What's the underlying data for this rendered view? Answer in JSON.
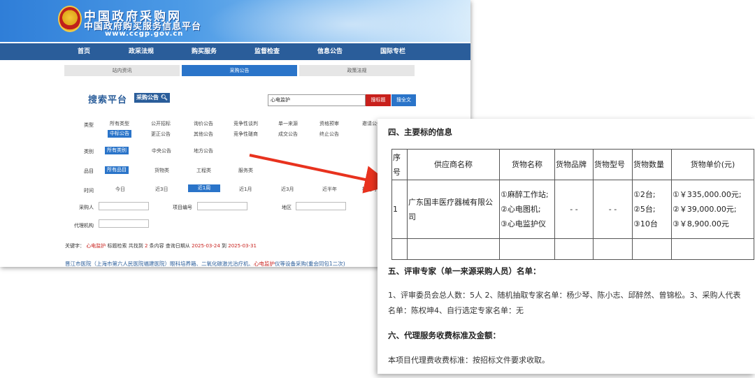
{
  "site": {
    "title": "中国政府采购网",
    "subtitle": "中国政府购买服务信息平台",
    "domain": "www.ccgp.gov.cn"
  },
  "nav": {
    "items": [
      "首页",
      "政采法规",
      "购买服务",
      "监督检查",
      "信息公告",
      "国际专栏"
    ]
  },
  "subtabs": {
    "items": [
      "站内资讯",
      "采购公告",
      "政策法规"
    ],
    "active_index": 1
  },
  "search": {
    "logo_text": "搜索平台",
    "logo_badge": "采购公告",
    "query": "心电监护",
    "btn_title": "搜标题",
    "btn_full": "搜全文"
  },
  "filters": {
    "type_label": "类型",
    "type_row1": [
      "所有类型",
      "公开招标",
      "询价公告",
      "竞争性谈判",
      "单一来源",
      "资格预审",
      "邀请公告"
    ],
    "type_row2": [
      "中标公告",
      "更正公告",
      "其他公告",
      "竞争性磋商",
      "成交公告",
      "终止公告"
    ],
    "category_label": "类别",
    "category_options": [
      "所有类别",
      "中央公告",
      "地方公告"
    ],
    "item_label": "品目",
    "item_options": [
      "所有品目",
      "货物类",
      "工程类",
      "服务类"
    ],
    "time_label": "时间",
    "time_options": [
      "今日",
      "近3日",
      "近1周",
      "近1月",
      "近3月",
      "近半年",
      "指定时"
    ],
    "purchaser_label": "采购人",
    "project_no_label": "项目编号",
    "region_label": "地区",
    "agency_label": "代理机构"
  },
  "results": {
    "keyword_label": "关键字：",
    "keyword": "心电监护",
    "summary_a": "标题检索 共找到",
    "count": "2",
    "summary_b": "条内容 查询日期从",
    "date_from": "2025-03-24",
    "summary_c": "到",
    "date_to": "2025-03-31",
    "first_link_a": "晋江市医院（上海市第六人民医院福建医院）眼科培养箱、二氧化碳激光治疗机、",
    "first_link_hl": "心电监护",
    "first_link_b": "仪等设备采购(重会同包1二次)"
  },
  "doc": {
    "section4_title": "四、主要标的信息",
    "table_headers": [
      "序号",
      "供应商名称",
      "货物名称",
      "货物品牌",
      "货物型号",
      "货物数量",
      "货物单价(元)"
    ],
    "row": {
      "no": "1",
      "supplier": "广东国丰医疗器械有限公司",
      "goods": [
        "①麻醉工作站;",
        "②心电图机;",
        "③心电监护仪"
      ],
      "brand": "- -",
      "model": "- -",
      "quantity": [
        "①2台;",
        "②5台;",
        "③10台"
      ],
      "price": [
        "①￥335,000.00元;",
        "②￥39,000.00元;",
        "③￥8,900.00元"
      ]
    },
    "section5_title": "五、评审专家（单一来源采购人员）名单：",
    "section5_body": "1、评审委员会总人数：5人 2、随机抽取专家名单：杨少琴、陈小志、邱醉然、曾锦松。3、采购人代表名单：陈权坤4、自行选定专家名单：无",
    "section6_title": "六、代理服务收费标准及金额：",
    "section6_body": "本项目代理费收费标准：按招标文件要求收取。"
  },
  "colors": {
    "nav_blue": "#2a5d9a",
    "accent_blue": "#2a74c9",
    "accent_red": "#c8201c",
    "arrow_red": "#e8321e"
  }
}
